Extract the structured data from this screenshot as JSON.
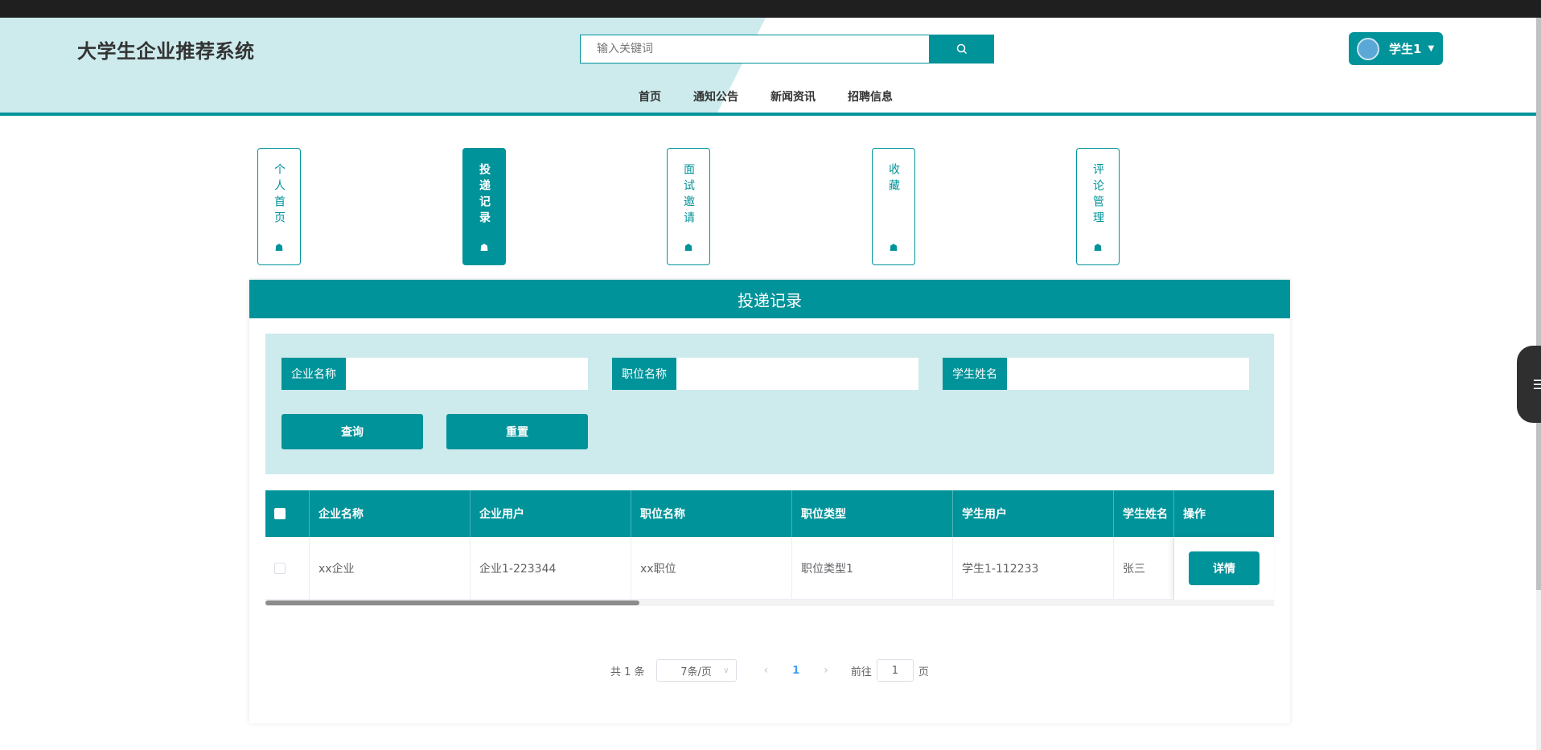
{
  "header": {
    "site_title": "大学生企业推荐系统",
    "search_placeholder": "输入关键词",
    "user_name": "学生1"
  },
  "nav": [
    "首页",
    "通知公告",
    "新闻资讯",
    "招聘信息"
  ],
  "side_menu": [
    {
      "label": "个人首页",
      "active": false
    },
    {
      "label": "投递记录",
      "active": true
    },
    {
      "label": "面试邀请",
      "active": false
    },
    {
      "label": "收藏",
      "active": false
    },
    {
      "label": "评论管理",
      "active": false
    }
  ],
  "panel": {
    "title": "投递记录",
    "filters": [
      {
        "label": "企业名称",
        "value": ""
      },
      {
        "label": "职位名称",
        "value": ""
      },
      {
        "label": "学生姓名",
        "value": ""
      }
    ],
    "query_button": "查询",
    "reset_button": "重置"
  },
  "table": {
    "columns": [
      "企业名称",
      "企业用户",
      "职位名称",
      "职位类型",
      "学生用户",
      "学生姓名",
      "操作"
    ],
    "rows": [
      {
        "company": "xx企业",
        "company_user": "企业1-223344",
        "job_name": "xx职位",
        "job_type": "职位类型1",
        "student_user": "学生1-112233",
        "student_name": "张三",
        "action": "详情"
      }
    ]
  },
  "pagination": {
    "total": "共 1 条",
    "page_size": "7条/页",
    "current": "1",
    "goto_prefix": "前往",
    "goto_value": "1",
    "goto_suffix": "页"
  },
  "colors": {
    "accent": "#00939a",
    "light": "#cdeaec"
  }
}
